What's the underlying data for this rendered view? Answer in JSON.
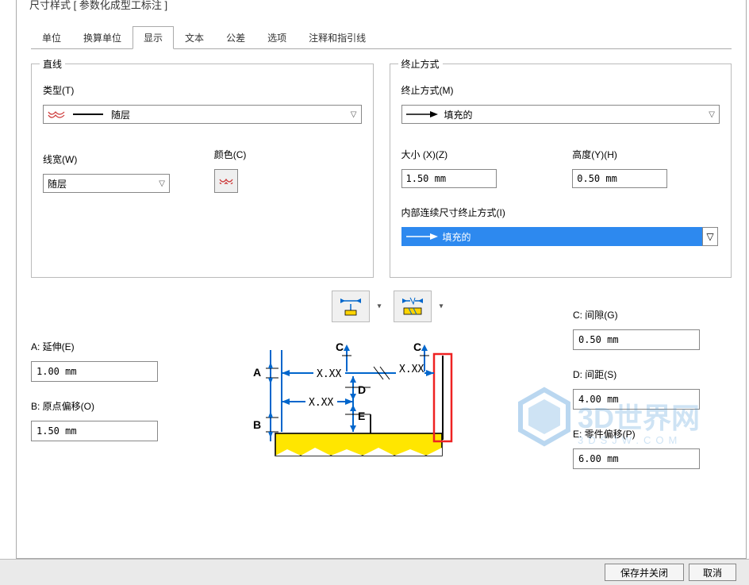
{
  "title": "尺寸样式 [ 参数化成型工标注 ]",
  "tabs": {
    "unit": "单位",
    "convert_unit": "换算单位",
    "display": "显示",
    "text": "文本",
    "tolerance": "公差",
    "options": "选项",
    "annotation": "注释和指引线"
  },
  "group_line": {
    "legend": "直线",
    "type_label": "类型(T)",
    "type_value": "随层",
    "linewidth_label": "线宽(W)",
    "linewidth_value": "随层",
    "color_label": "颜色(C)"
  },
  "group_term": {
    "legend": "终止方式",
    "term_label": "终止方式(M)",
    "term_value": "填充的",
    "size_label": "大小 (X)(Z)",
    "size_value": "1.50 mm",
    "height_label": "高度(Y)(H)",
    "height_value": "0.50 mm",
    "inner_label": "内部连续尺寸终止方式(I)",
    "inner_value": "填充的"
  },
  "diagram": {
    "A": "A",
    "B": "B",
    "C": "C",
    "D": "D",
    "E": "E",
    "xxx": "X.XX"
  },
  "params": {
    "A_label": "A: 延伸(E)",
    "A_value": "1.00 mm",
    "B_label": "B: 原点偏移(O)",
    "B_value": "1.50 mm",
    "C_label": "C: 间隙(G)",
    "C_value": "0.50 mm",
    "D_label": "D: 间距(S)",
    "D_value": "4.00 mm",
    "E_label": "E: 零件偏移(P)",
    "E_value": "6.00 mm"
  },
  "footer": {
    "save_close": "保存并关闭",
    "cancel": "取消"
  }
}
